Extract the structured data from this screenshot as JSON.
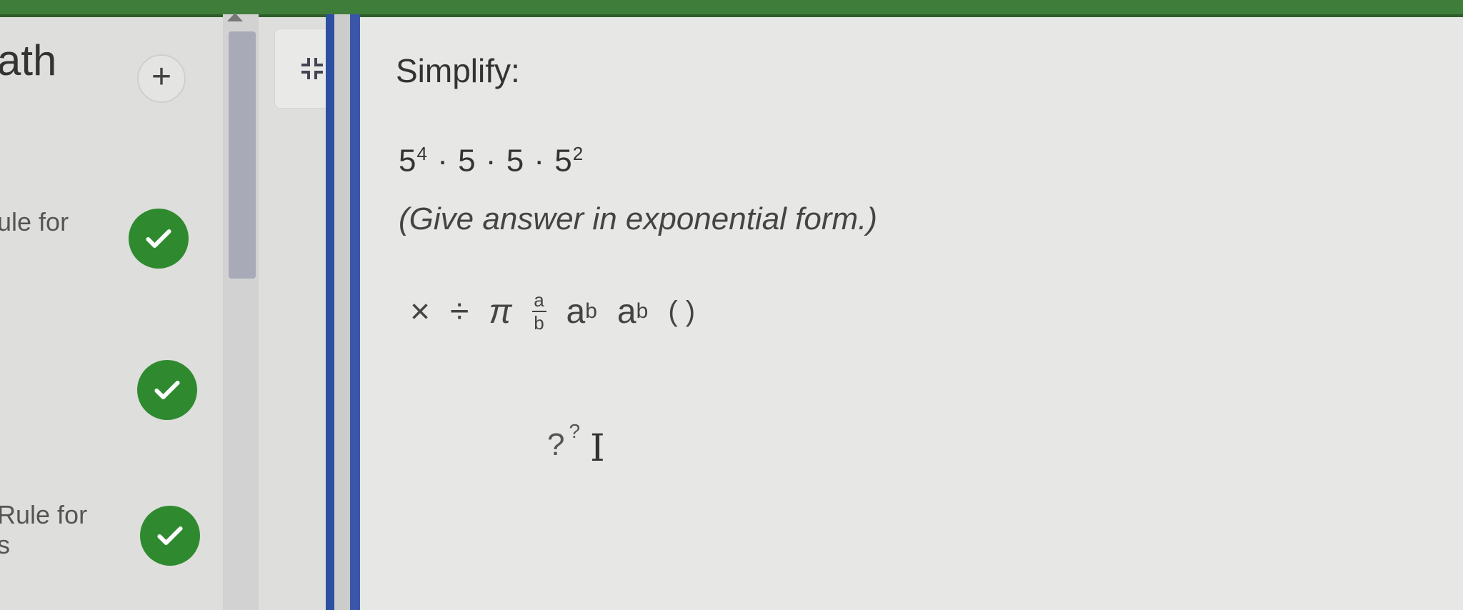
{
  "sidebar": {
    "course_title": "ath",
    "add_label": "+",
    "lessons": [
      {
        "line1": "ule for",
        "line2": "",
        "status": "complete"
      },
      {
        "line1": "",
        "line2": "",
        "status": "complete"
      },
      {
        "line1": "Rule for",
        "line2": "s",
        "status": "complete"
      }
    ]
  },
  "question": {
    "prompt": "Simplify:",
    "expression": {
      "t1_base": "5",
      "t1_exp": "4",
      "dot": "·",
      "t2": "5",
      "t3": "5",
      "t4_base": "5",
      "t4_exp": "2"
    },
    "instruction": "(Give answer in exponential form.)"
  },
  "toolbar": {
    "times": "×",
    "divide": "÷",
    "pi": "π",
    "frac_num": "a",
    "frac_den": "b",
    "pow_base": "a",
    "pow_exp": "b",
    "sub_base": "a",
    "sub_sub": "b",
    "parens": "( )"
  },
  "answer": {
    "base": "?",
    "exponent": "?",
    "cursor": "I"
  },
  "colors": {
    "topbar": "#3f7d3a",
    "check": "#2f8a2f",
    "divider": "#2d4fa0"
  }
}
